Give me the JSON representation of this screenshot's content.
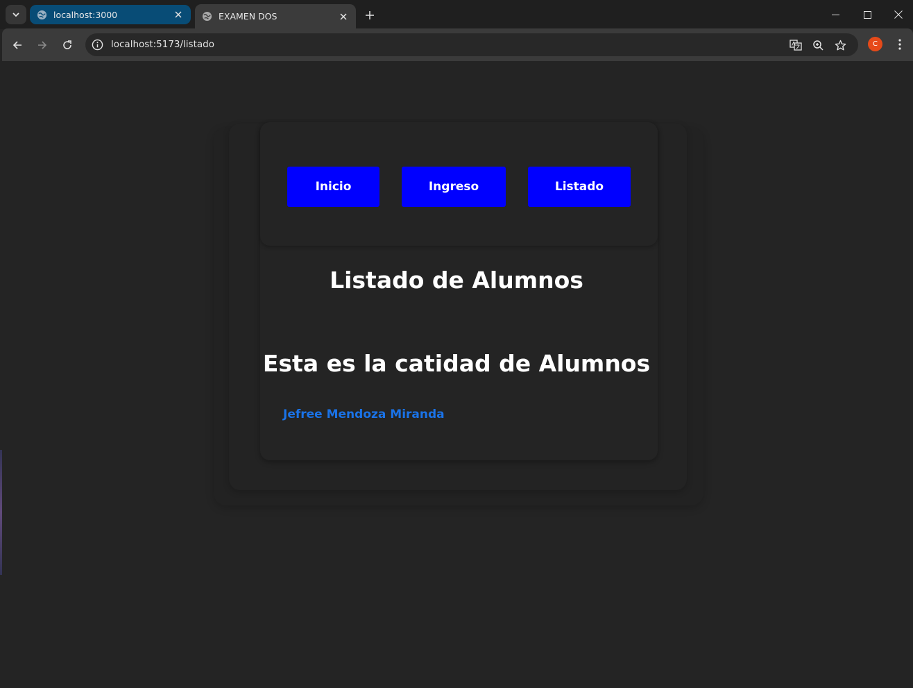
{
  "browser": {
    "tabs": [
      {
        "title": "localhost:3000",
        "active": false
      },
      {
        "title": "EXAMEN DOS",
        "active": true
      }
    ],
    "url": "localhost:5173/listado",
    "profile_initial": "C"
  },
  "nav": {
    "buttons": [
      {
        "label": "Inicio"
      },
      {
        "label": "Ingreso"
      },
      {
        "label": "Listado"
      }
    ],
    "button_color": "#0000ff"
  },
  "main": {
    "title": "Listado de Alumnos",
    "subtitle": "Esta es la catidad de Alumnos",
    "students": [
      "Jefree Mendoza Miranda"
    ],
    "link_color": "#1a73e8"
  }
}
